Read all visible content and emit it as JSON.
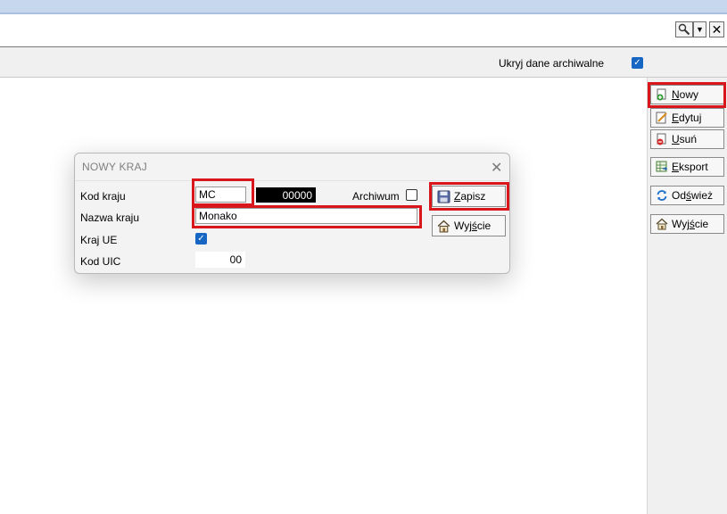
{
  "filter": {
    "hide_archive_label": "Ukryj dane archiwalne",
    "hide_archive_checked": true
  },
  "side_buttons": {
    "new": {
      "label_u": "N",
      "label_rest": "owy"
    },
    "edit": {
      "label_u": "E",
      "label_rest": "dytuj"
    },
    "delete": {
      "label_u": "U",
      "label_rest": "suń"
    },
    "export": {
      "label_u": "E",
      "label_rest": "ksport"
    },
    "refresh": {
      "label_pre": "Od",
      "label_u": "ś",
      "label_rest": "wież"
    },
    "exit": {
      "label_pre": "Wyj",
      "label_u": "ś",
      "label_rest": "cie"
    }
  },
  "dialog": {
    "title": "NOWY KRAJ",
    "close_glyph": "✕",
    "fields": {
      "country_code_label": "Kod kraju",
      "country_code_value": "MC",
      "country_number": "00000",
      "archive_label": "Archiwum",
      "archive_checked": false,
      "country_name_label": "Nazwa kraju",
      "country_name_value": "Monako",
      "eu_label": "Kraj UE",
      "eu_checked": true,
      "uic_label": "Kod UIC",
      "uic_value": "00"
    },
    "buttons": {
      "save": {
        "label_u": "Z",
        "label_rest": "apisz"
      },
      "exit": {
        "label_pre": "Wyj",
        "label_u": "ś",
        "label_rest": "cie"
      }
    }
  },
  "icons": {
    "check": "✓",
    "dropdown": "▼",
    "close": "✕"
  }
}
